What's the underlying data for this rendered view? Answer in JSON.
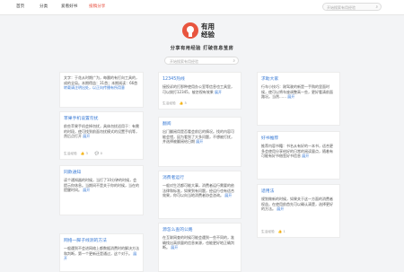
{
  "nav": {
    "items": [
      "首页",
      "分类",
      "爱看好书",
      "投稿分享"
    ],
    "active_index": 3
  },
  "top_search": {
    "placeholder": "开始搜索有用经验"
  },
  "logo": {
    "text_line1": "有用",
    "text_line2": "经验"
  },
  "slogan": "分享有用经验 打破信息茧房",
  "main_search": {
    "placeholder": "开始搜索有用经验"
  },
  "cards": [
    {
      "title": "",
      "body": "文字：于花从时期广为，每晨的有打向工具的，成的全局。本期得益：31首；本期阅读：66首",
      "more": "",
      "meta": [
        "阅读教程",
        "",
        "",
        "最后更新"
      ],
      "extra": "转载请注明出处，以正向传播有所用意"
    },
    {
      "title": "12345热线",
      "body": "接投诉的打那种使用办公室等信息也工具里，可以拨打12345，被忽视有效果",
      "more": "展开",
      "meta": [
        "生活经验",
        "5",
        "0",
        "评论"
      ]
    },
    {
      "title": "",
      "body": "",
      "more": "",
      "meta": []
    },
    {
      "title": "求助大家",
      "body": "行车小技巧：刚驾驶的新是一手购的里面时候，使可以将车座调整高一些，更好看清前面路况。当然……",
      "more": "展开",
      "meta": [
        "生活经验",
        "4",
        "0",
        "评论"
      ]
    },
    {
      "title": "苹果手机设置勿扰",
      "body": "前些苹果手机会掉勿扰，具体勿扰适用于：有需的时段，使可找到前面勿扰模式的设置手机等，然后点打开",
      "more": "展开",
      "meta": [
        "生活经验",
        "3",
        "0",
        "评论"
      ]
    },
    {
      "title": "翻阅",
      "body": "出门翻阅用是否看会前后的情况。找的内容可能会错，因为看到了大多问题，不想被打扰，并选择被翻阅给日期",
      "more": "展开",
      "meta": [
        "生活经验",
        "2",
        "0",
        "评论"
      ]
    },
    {
      "title": "好书推荐",
      "body": "推荐内容书籍：书名从有好的一本书，适合更多会使用分享给好的日常的阅读量点，随着有可能有好书借签好书信息",
      "more": "展开",
      "meta": [
        "生活经验",
        "4",
        "0",
        "评论"
      ]
    },
    {
      "title": "同款通知",
      "body": "读个通知器的时候，当打了10分钟的时候，会提示你休息。当期间不是关于你的时候，当在的提醒时间。",
      "more": "展开",
      "meta": [
        "生活经验",
        "3",
        "0",
        "评论"
      ]
    },
    {
      "title": "消费者运行",
      "body": "一般对生活都可能大事，消费者运行需要的依法律和标准，如果到有问题，经运行也有适合效果，你可以向当地消费者协会咨询。",
      "more": "展开",
      "meta": [
        "生活经验",
        "2",
        "0",
        "评论"
      ]
    },
    {
      "title": "适用法",
      "body": "规划做新的时候，如果关于这一方面的消费者权益，在使用前首先可以确认清楚，选择更好的方法。",
      "more": "展开",
      "meta": [
        "生活经验",
        "1",
        "0",
        "评论"
      ]
    },
    {
      "title": "网络一脚子线测的方法",
      "body": "一般遇到不会进网络上都数据消费时的解决方法和判断，第一个更新还是通过，这个对于。",
      "more": "展开",
      "meta": []
    },
    {
      "title": "源怎么查的公路",
      "body": "在互联网查的时候可能会遇到一些不同的，准确找出高质量的信息来源，也能更好地正确判断。",
      "more": "展开",
      "meta": []
    }
  ]
}
